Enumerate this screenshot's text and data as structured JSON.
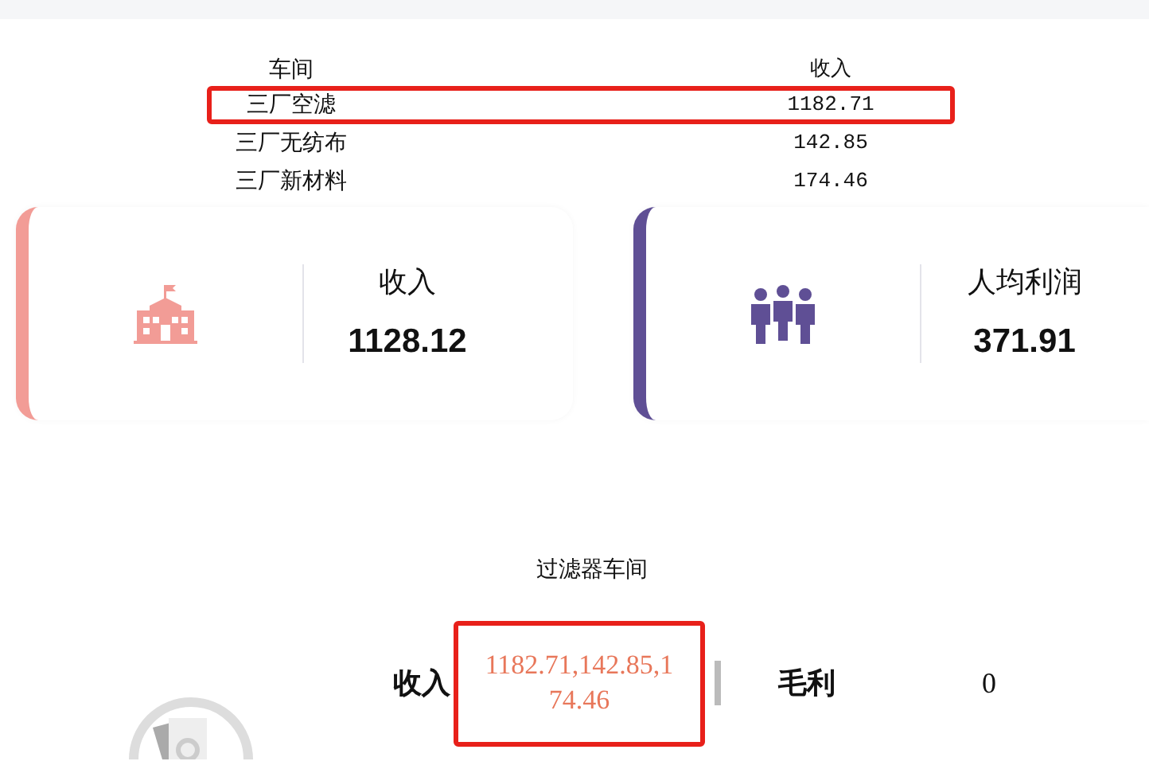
{
  "table": {
    "columns": [
      "车间",
      "收入"
    ],
    "rows": [
      {
        "cells": [
          "三厂空滤",
          "1182.71"
        ],
        "highlighted": true
      },
      {
        "cells": [
          "三厂无纺布",
          "142.85"
        ],
        "highlighted": false
      },
      {
        "cells": [
          "三厂新材料",
          "174.46"
        ],
        "highlighted": false
      }
    ]
  },
  "stat_cards": [
    {
      "kind": "building",
      "label": "收入",
      "value": "1128.12",
      "color": "#f29c96"
    },
    {
      "kind": "people",
      "label": "人均利润",
      "value": "371.91",
      "color": "#5f4f95"
    }
  ],
  "filter_section": {
    "title": "过滤器车间",
    "income_label": "收入",
    "income_value": "1182.71,142.85,174.46",
    "income_highlighted": true,
    "profit_label": "毛利",
    "profit_value": "0"
  }
}
